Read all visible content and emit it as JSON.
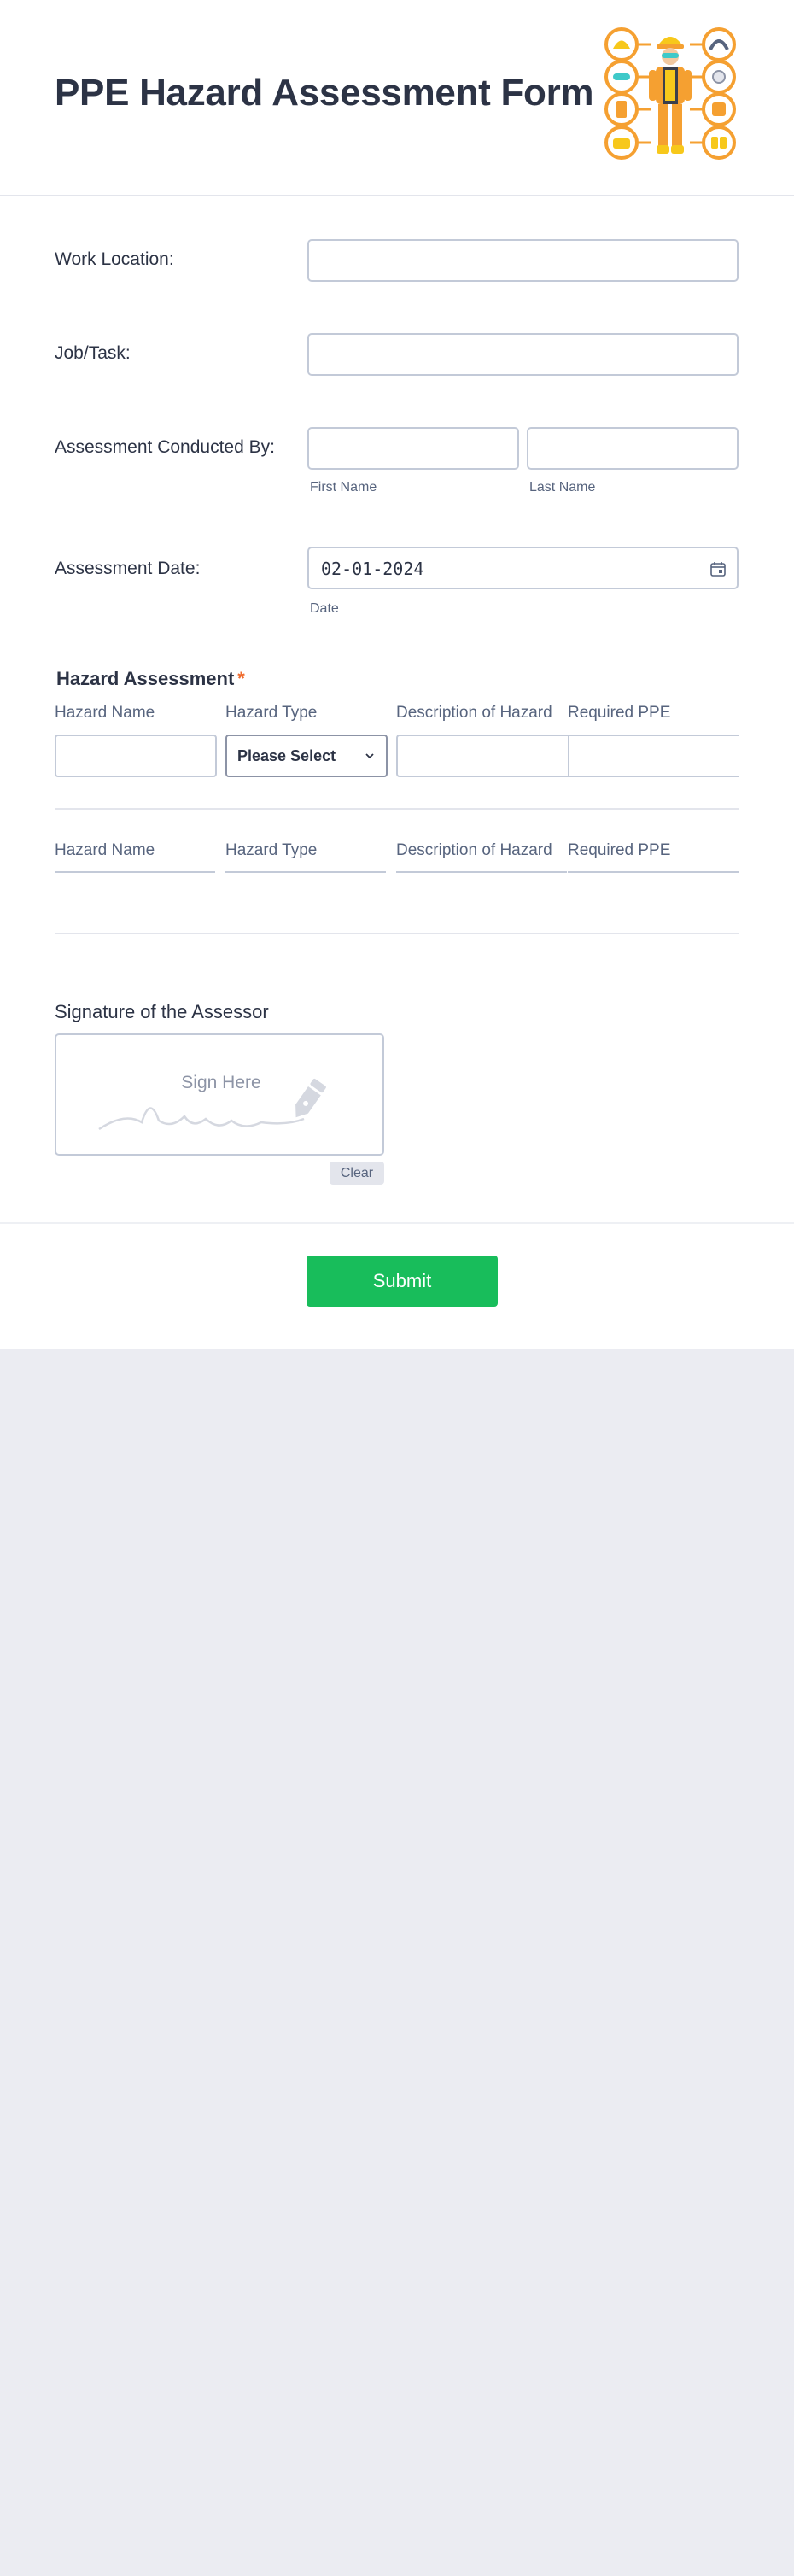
{
  "form": {
    "title": "PPE Hazard Assessment Form",
    "illustration_icon": "ppe-worker-illustration"
  },
  "fields": {
    "work_location": {
      "label": "Work Location:",
      "value": ""
    },
    "job_task": {
      "label": "Job/Task:",
      "value": ""
    },
    "conducted_by": {
      "label": "Assessment Conducted By:",
      "first_name_sublabel": "First Name",
      "last_name_sublabel": "Last Name",
      "first_name_value": "",
      "last_name_value": ""
    },
    "assessment_date": {
      "label": "Assessment Date:",
      "value": "02-01-2024",
      "sublabel": "Date",
      "icon": "calendar-icon"
    }
  },
  "hazard_table": {
    "title": "Hazard Assessment",
    "required_marker": "*",
    "columns": [
      "Hazard Name",
      "Hazard Type",
      "Description of Hazard",
      "Required PPE"
    ],
    "row1": {
      "hazard_type_selected": "Please Select"
    },
    "second_columns": [
      "Hazard Name",
      "Hazard Type",
      "Description of Hazard",
      "Required PPE"
    ]
  },
  "signature": {
    "label": "Signature of the Assessor",
    "placeholder": "Sign Here",
    "clear_label": "Clear"
  },
  "submit": {
    "label": "Submit"
  },
  "colors": {
    "accent_submit": "#18bd5b",
    "required_star": "#f06c2f",
    "page_background": "#ebecf2",
    "illustration_orange": "#f5a031",
    "illustration_yellow": "#f7c81b"
  }
}
